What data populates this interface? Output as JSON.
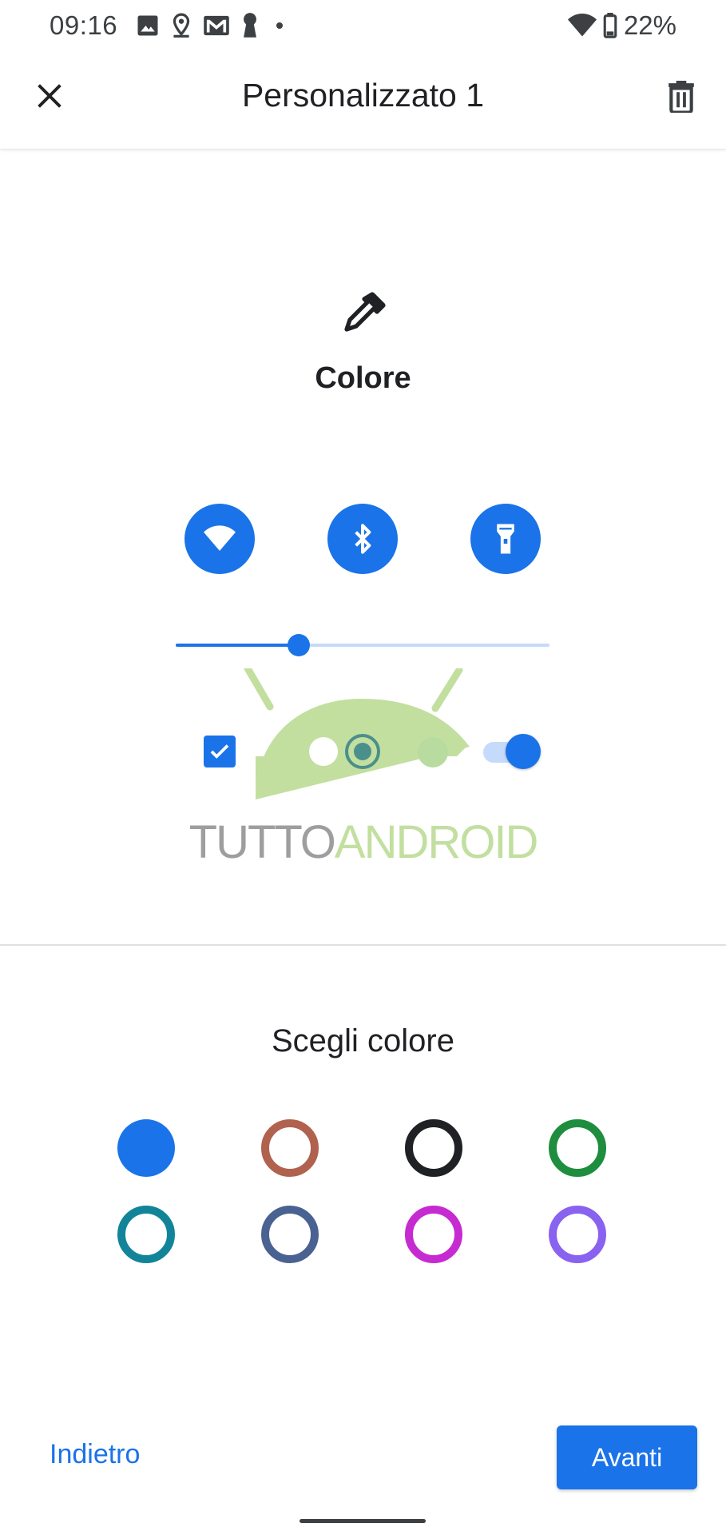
{
  "status_bar": {
    "time": "09:16",
    "left_icons": [
      "image-icon",
      "location-icon",
      "gmail-icon",
      "keyhole-icon",
      "dot-icon"
    ],
    "right_icons": [
      "wifi-icon",
      "battery-icon"
    ],
    "battery": "22%"
  },
  "app_bar": {
    "title": "Personalizzato 1",
    "close_icon": "close-icon",
    "delete_icon": "trash-icon"
  },
  "preview": {
    "icon": "eyedropper-icon",
    "title": "Colore",
    "quick_settings": [
      "wifi-icon",
      "bluetooth-icon",
      "flashlight-icon"
    ],
    "slider_value": 0.33,
    "checkbox_checked": true,
    "toggle_on": true,
    "accent_color": "#1a73e8"
  },
  "watermark": {
    "part1": "TUTTO",
    "part2": "ANDROID"
  },
  "color_picker": {
    "title": "Scegli colore",
    "colors": [
      {
        "name": "blue",
        "hex": "#1a73e8",
        "selected": true
      },
      {
        "name": "brown",
        "hex": "#b0624f",
        "selected": false
      },
      {
        "name": "black",
        "hex": "#202124",
        "selected": false
      },
      {
        "name": "green",
        "hex": "#1e8e3e",
        "selected": false
      },
      {
        "name": "teal",
        "hex": "#12849a",
        "selected": false
      },
      {
        "name": "slate",
        "hex": "#4a6291",
        "selected": false
      },
      {
        "name": "magenta",
        "hex": "#c62bd1",
        "selected": false
      },
      {
        "name": "purple",
        "hex": "#8a62f0",
        "selected": false
      }
    ]
  },
  "footer": {
    "back_label": "Indietro",
    "next_label": "Avanti"
  }
}
